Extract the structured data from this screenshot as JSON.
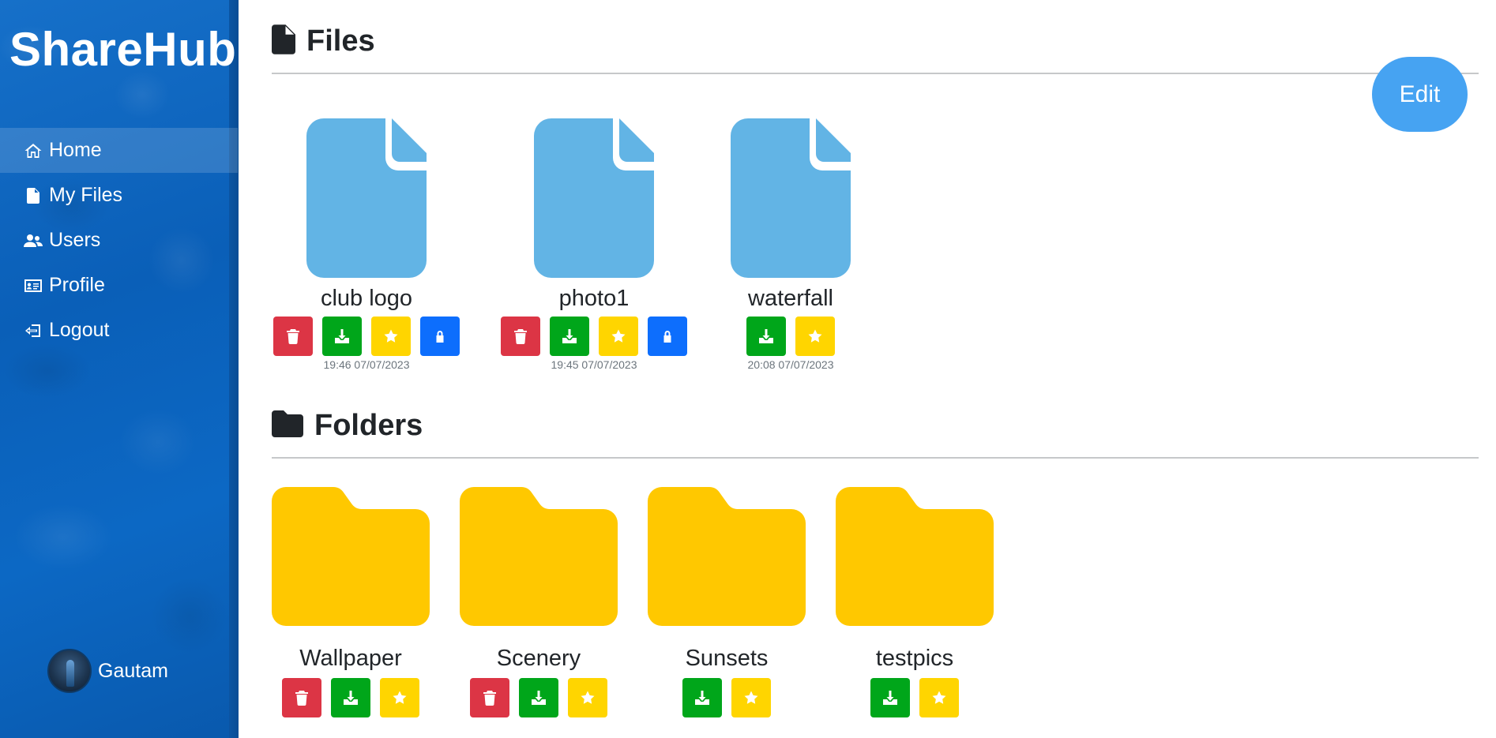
{
  "app": {
    "brand": "ShareHub"
  },
  "sidebar": {
    "items": [
      {
        "label": "Home",
        "icon": "house-icon"
      },
      {
        "label": "My Files",
        "icon": "file-icon"
      },
      {
        "label": "Users",
        "icon": "users-icon"
      },
      {
        "label": "Profile",
        "icon": "id-card-icon"
      },
      {
        "label": "Logout",
        "icon": "logout-icon"
      }
    ],
    "user": {
      "name": "Gautam"
    }
  },
  "main": {
    "edit_label": "Edit",
    "files": {
      "title": "Files",
      "items": [
        {
          "name": "club logo",
          "time": "19:46 07/07/2023",
          "actions": [
            "delete",
            "download",
            "favorite",
            "lock"
          ]
        },
        {
          "name": "photo1",
          "time": "19:45 07/07/2023",
          "actions": [
            "delete",
            "download",
            "favorite",
            "lock"
          ]
        },
        {
          "name": "waterfall",
          "time": "20:08 07/07/2023",
          "actions": [
            "download",
            "favorite"
          ]
        }
      ]
    },
    "folders": {
      "title": "Folders",
      "items": [
        {
          "name": "Wallpaper",
          "actions": [
            "delete",
            "download",
            "favorite"
          ]
        },
        {
          "name": "Scenery",
          "actions": [
            "delete",
            "download",
            "favorite"
          ]
        },
        {
          "name": "Sunsets",
          "actions": [
            "download",
            "favorite"
          ]
        },
        {
          "name": "testpics",
          "actions": [
            "download",
            "favorite"
          ]
        }
      ]
    },
    "colors": {
      "sidebar": "#0a63be",
      "file_icon": "#62b4e5",
      "folder_icon": "#ffc800",
      "delete": "#dc3545",
      "download": "#00a61a",
      "favorite": "#ffd500",
      "lock": "#0d6efd",
      "edit": "#46a3f2"
    }
  }
}
